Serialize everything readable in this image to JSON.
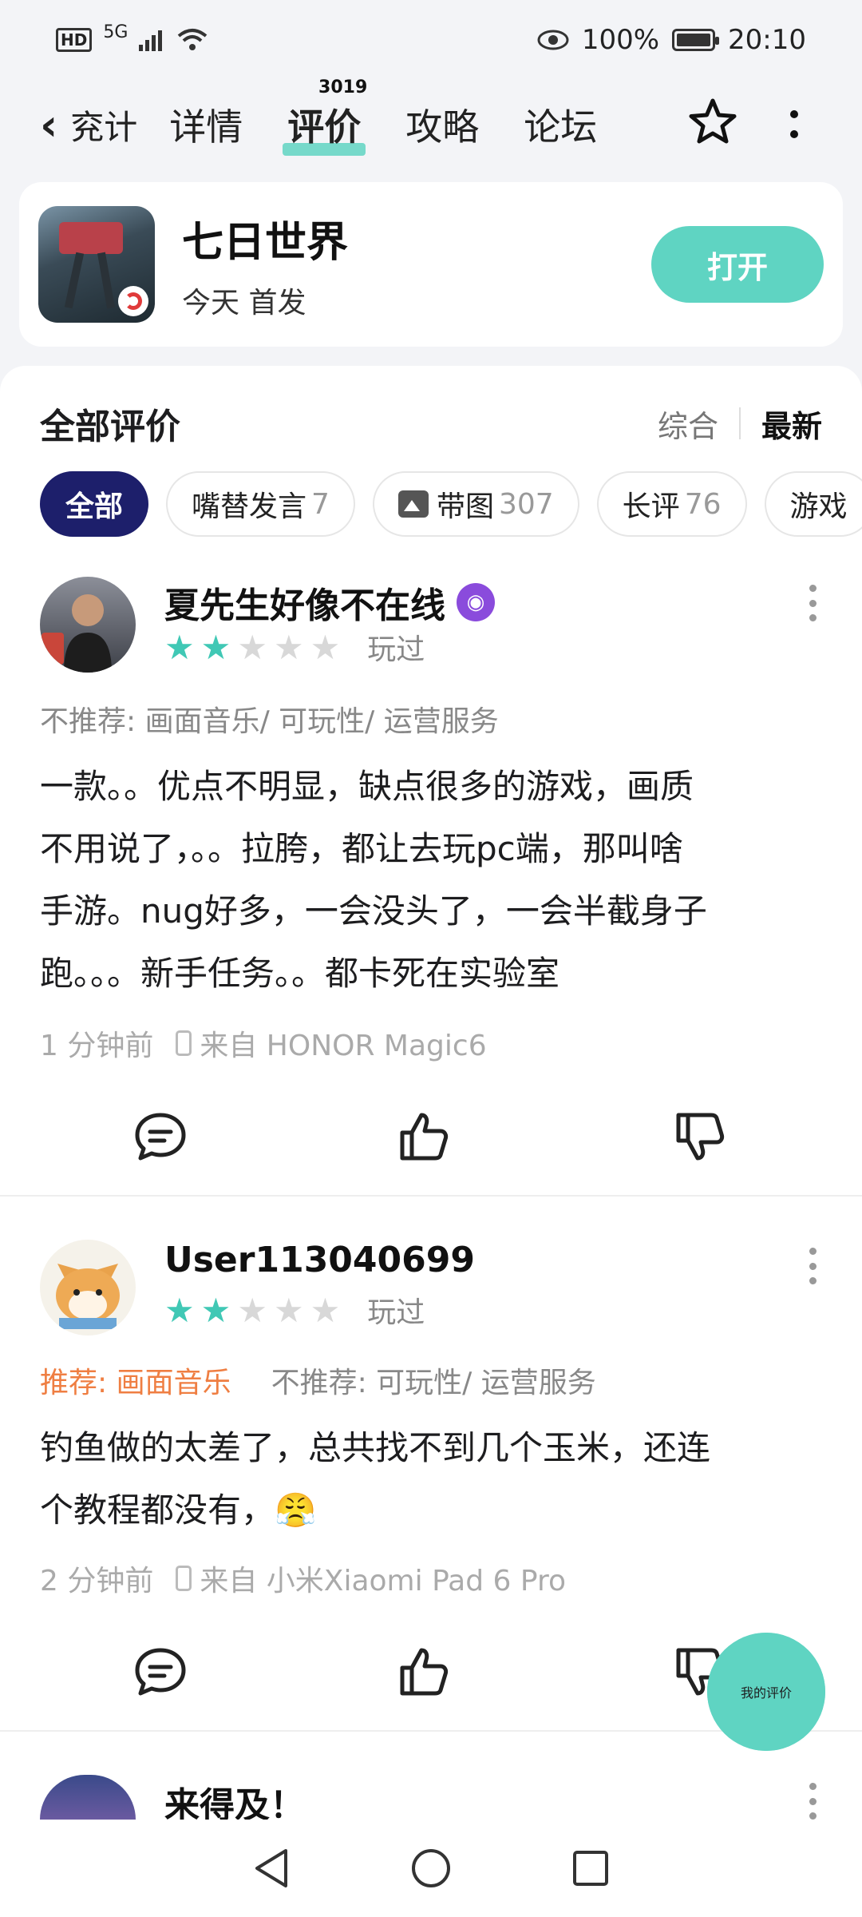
{
  "status_bar": {
    "network": "5G",
    "battery": "100%",
    "time": "20:10"
  },
  "nav": {
    "back_label": "兖计",
    "tabs": [
      {
        "label": "详情"
      },
      {
        "label": "评价",
        "badge": "3019",
        "active": true
      },
      {
        "label": "攻略"
      },
      {
        "label": "论坛"
      }
    ]
  },
  "app": {
    "name": "七日世界",
    "subtitle": "今天 首发",
    "open_label": "打开"
  },
  "reviews_section": {
    "title": "全部评价",
    "sort": [
      {
        "label": "综合"
      },
      {
        "label": "最新",
        "active": true
      }
    ],
    "chips": [
      {
        "label": "全部",
        "active": true
      },
      {
        "label": "嘴替发言",
        "count": "7"
      },
      {
        "label": "带图",
        "count": "307"
      },
      {
        "label": "长评",
        "count": "76"
      },
      {
        "label": "游戏"
      }
    ]
  },
  "reviews": [
    {
      "name": "夏先生好像不在线",
      "rating": 2,
      "played": "玩过",
      "recommend": "",
      "not_recommend": "不推荐: 画面音乐/ 可玩性/ 运营服务",
      "lines": [
        "一款。。优点不明显，缺点很多的游戏，画质",
        "不用说了，。。拉胯，都让去玩pc端，那叫啥",
        "手游。nug好多，一会没头了，一会半截身子",
        "跑。。。新手任务。。都卡死在实验室"
      ],
      "time": "1 分钟前",
      "device": "来自 HONOR Magic6"
    },
    {
      "name": "User113040699",
      "rating": 2,
      "played": "玩过",
      "recommend": "推荐: 画面音乐",
      "not_recommend": "不推荐: 可玩性/ 运营服务",
      "lines": [
        "钓鱼做的太差了，总共找不到几个玉米，还连",
        "个教程都没有，😤"
      ],
      "time": "2 分钟前",
      "device": "来自 小米Xiaomi Pad 6 Pro"
    },
    {
      "name": "来得及！"
    }
  ],
  "my_review_label": "我的评价",
  "colors": {
    "accent": "#5fd4c2",
    "active_chip": "#1d1f6b",
    "star": "#40c8b5",
    "recommend": "#ef7e42"
  }
}
